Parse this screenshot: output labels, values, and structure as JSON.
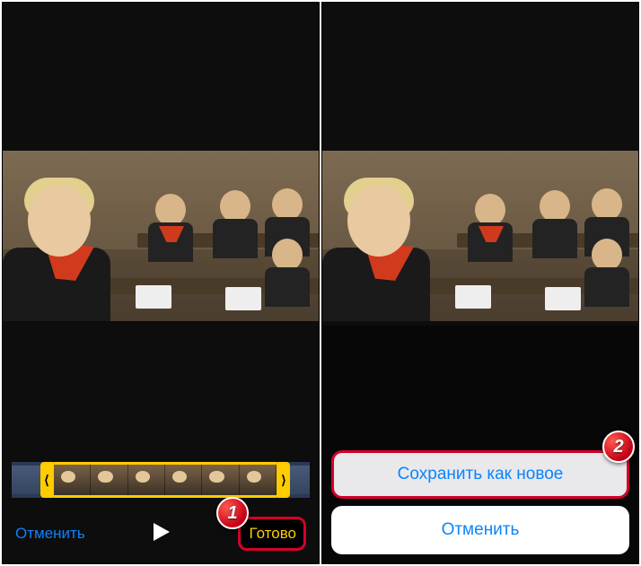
{
  "step_badges": {
    "one": "1",
    "two": "2"
  },
  "left": {
    "cancel": "Отменить",
    "done": "Готово",
    "trim_handle_left": "⟨",
    "trim_handle_right": "⟩"
  },
  "right": {
    "save_as_new": "Сохранить как новое",
    "cancel": "Отменить"
  },
  "colors": {
    "ios_blue": "#0a84ff",
    "ios_yellow": "#ffcc00",
    "callout_red": "#d4002a"
  }
}
